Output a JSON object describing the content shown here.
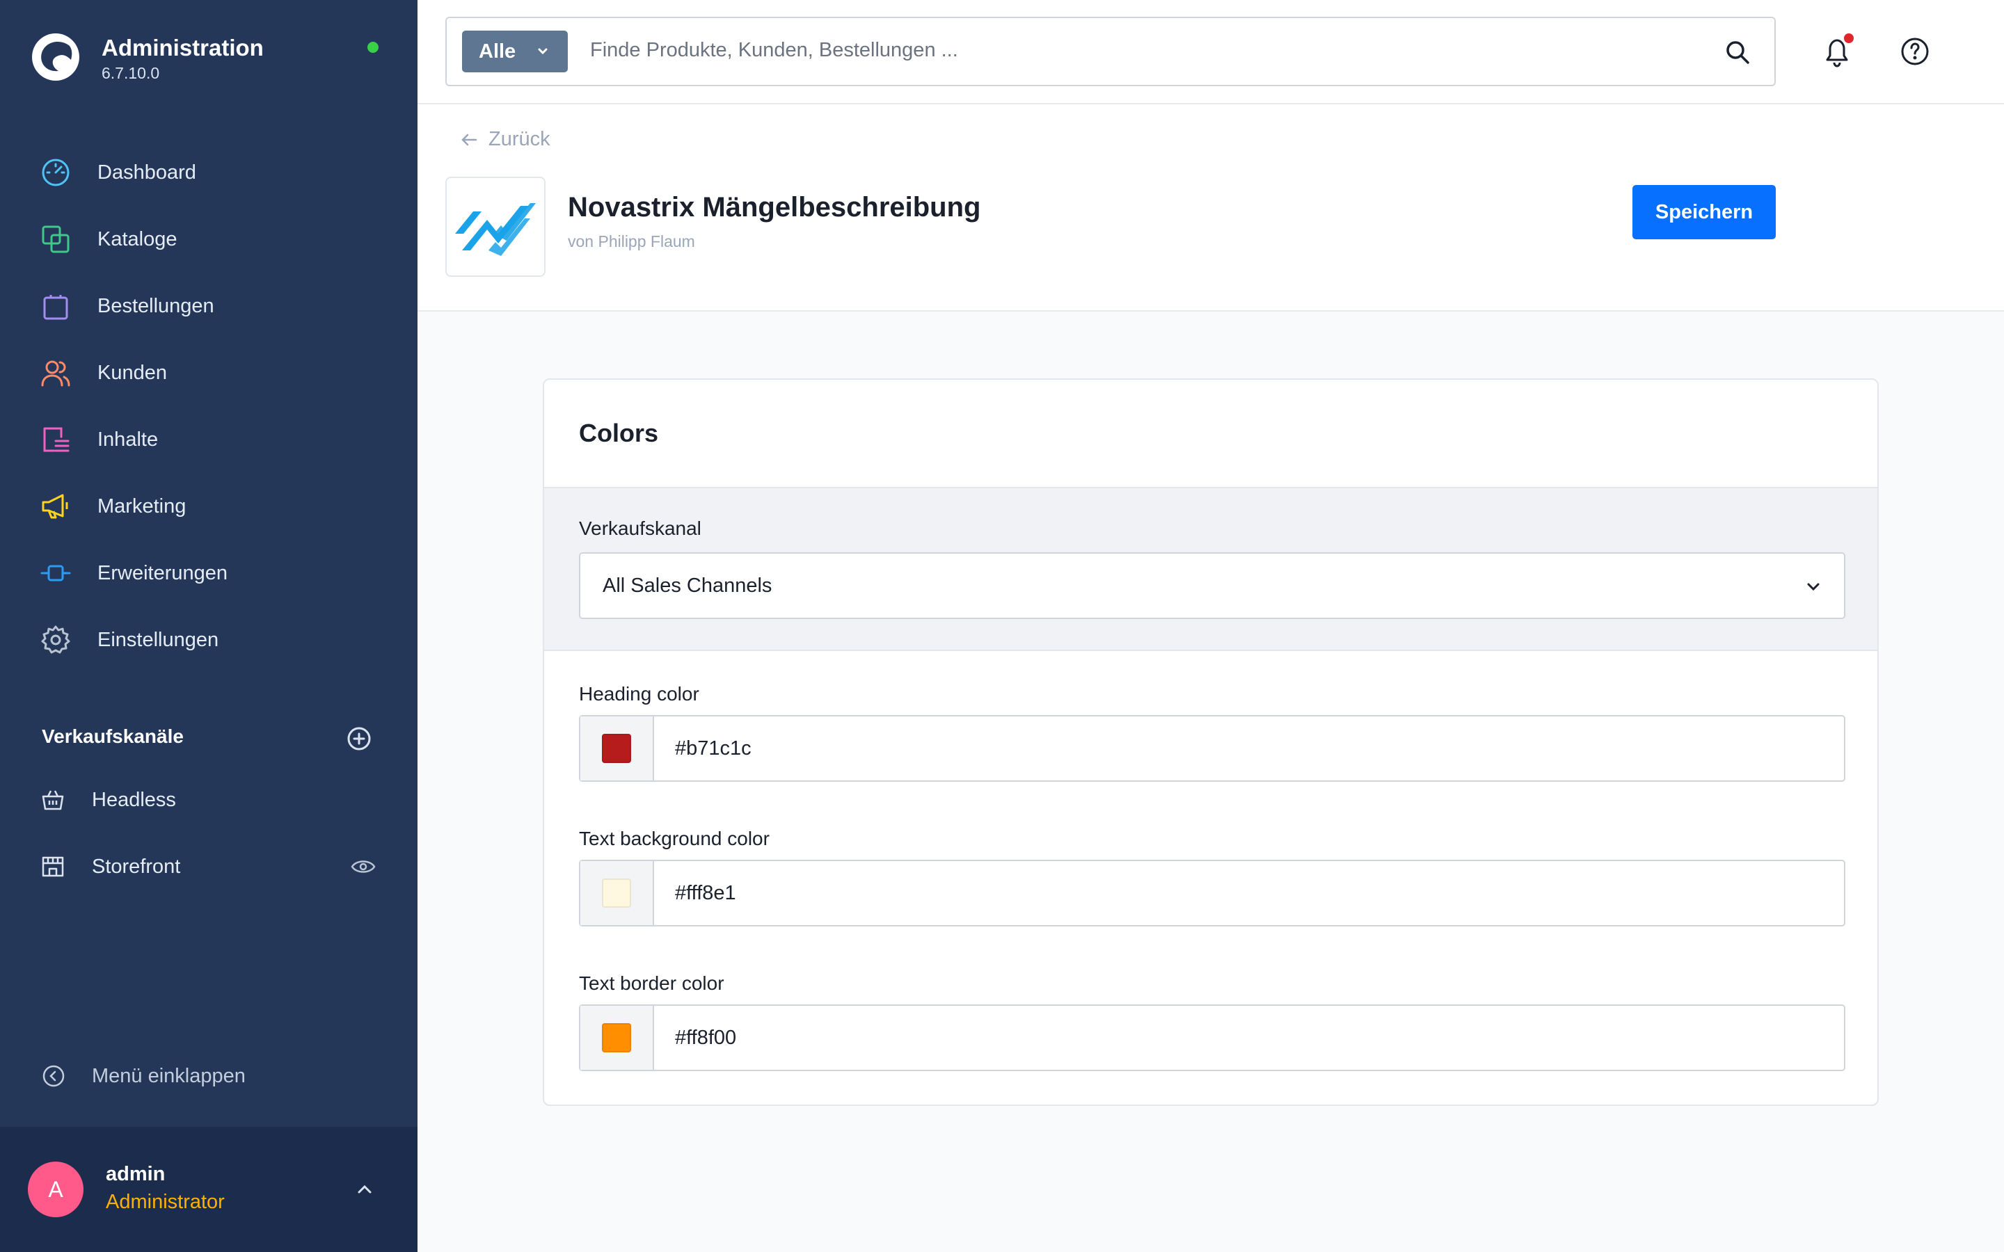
{
  "brand": {
    "title": "Administration",
    "version": "6.7.10.0"
  },
  "nav": [
    {
      "label": "Dashboard",
      "icon": "dashboard-icon",
      "color": "#4fc3f7"
    },
    {
      "label": "Kataloge",
      "icon": "catalog-icon",
      "color": "#3ec98a"
    },
    {
      "label": "Bestellungen",
      "icon": "orders-icon",
      "color": "#a48cf0"
    },
    {
      "label": "Kunden",
      "icon": "customers-icon",
      "color": "#ff8a65"
    },
    {
      "label": "Inhalte",
      "icon": "content-icon",
      "color": "#f062c0"
    },
    {
      "label": "Marketing",
      "icon": "marketing-icon",
      "color": "#ffd21f"
    },
    {
      "label": "Erweiterungen",
      "icon": "extensions-icon",
      "color": "#2b9cf2"
    },
    {
      "label": "Einstellungen",
      "icon": "settings-icon",
      "color": "#b9c4d2"
    }
  ],
  "sales_channels": {
    "title": "Verkaufskanäle",
    "items": [
      {
        "label": "Headless",
        "icon": "basket-icon"
      },
      {
        "label": "Storefront",
        "icon": "storefront-icon"
      }
    ]
  },
  "collapse_label": "Menü einklappen",
  "user": {
    "initial": "A",
    "name": "admin",
    "role": "Administrator"
  },
  "search": {
    "filter": "Alle",
    "placeholder": "Finde Produkte, Kunden, Bestellungen ..."
  },
  "header": {
    "back_label": "Zurück",
    "app_title": "Novastrix Mängelbeschreibung",
    "app_author": "von Philipp Flaum",
    "save_label": "Speichern"
  },
  "card": {
    "title": "Colors",
    "channel_label": "Verkaufskanal",
    "channel_value": "All Sales Channels",
    "fields": [
      {
        "label": "Heading color",
        "value": "#b71c1c"
      },
      {
        "label": "Text background color",
        "value": "#fff8e1"
      },
      {
        "label": "Text border color",
        "value": "#ff8f00"
      }
    ]
  },
  "colors": {
    "sidebar": "#243759",
    "primary": "#0870ff",
    "role": "#ffb000",
    "avatar": "#ff5a8a",
    "status": "#37d046"
  }
}
